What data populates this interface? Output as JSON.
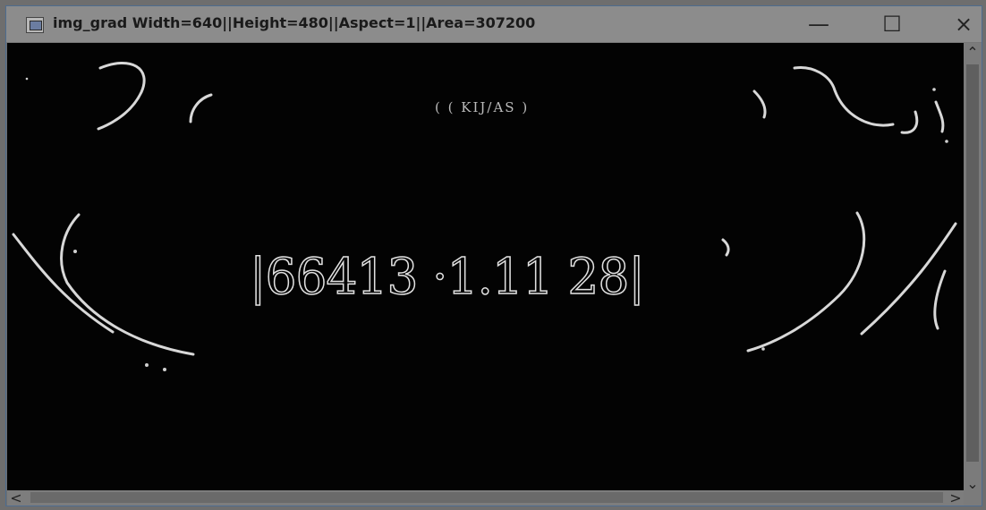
{
  "window": {
    "title": "img_grad Width=640||Height=480||Aspect=1||Area=307200",
    "controls": {
      "minimize": "—",
      "maximize": "☐",
      "close": "×"
    }
  },
  "icons": {
    "app": "app-icon",
    "up": "chevron-up-icon",
    "down": "chevron-down-icon",
    "left": "chevron-left-icon",
    "right": "chevron-right-icon"
  },
  "image": {
    "top_text": "( ( KIJ/AS )",
    "plate_text": "|66413 ·1.11 28|"
  },
  "scrollbars": {
    "up_arrow": "⌃",
    "down_arrow": "⌄",
    "left_arrow": "<",
    "right_arrow": ">"
  }
}
